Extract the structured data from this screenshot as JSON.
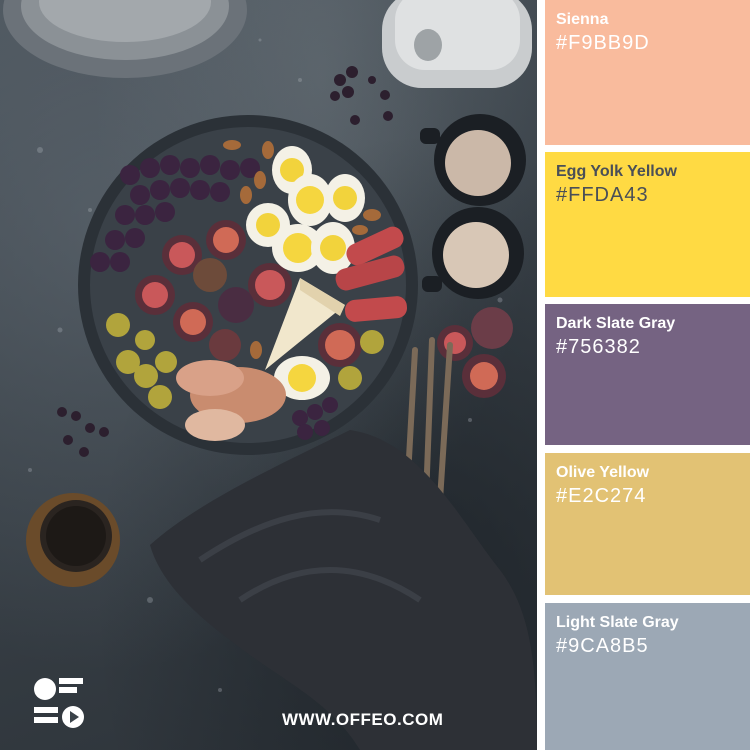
{
  "palette": [
    {
      "name": "Sienna",
      "hex": "#F9BB9D",
      "text_color": "#FFFFFF"
    },
    {
      "name": "Egg Yolk Yellow",
      "hex": "#FFDA43",
      "text_color": "#4A4F57"
    },
    {
      "name": "Dark Slate Gray",
      "hex": "#756382",
      "text_color": "#FFFFFF"
    },
    {
      "name": "Olive Yellow",
      "hex": "#E2C274",
      "text_color": "#FFFFFF"
    },
    {
      "name": "Light Slate Gray",
      "hex": "#9CA8B5",
      "text_color": "#FFFFFF"
    }
  ],
  "footer": {
    "url": "WWW.OFFEO.COM",
    "logo_icon": "offeo-logo-icon"
  },
  "photo": {
    "icon": "food-platter-photo"
  }
}
